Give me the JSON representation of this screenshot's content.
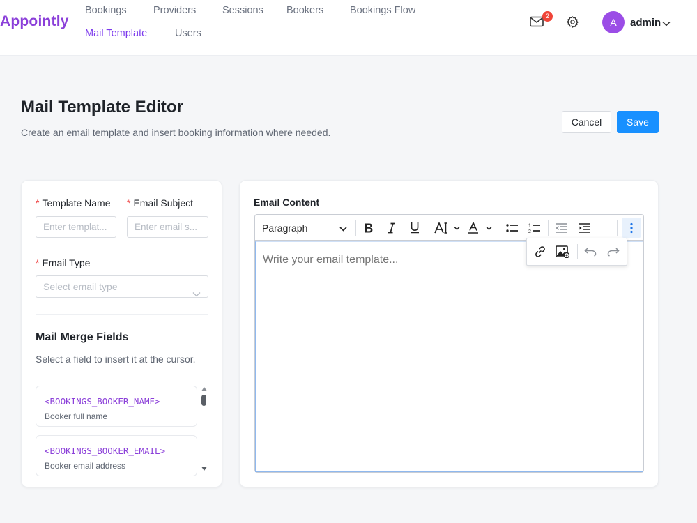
{
  "header": {
    "logo": "Appointly",
    "nav": {
      "bookings": "Bookings",
      "providers": "Providers",
      "sessions": "Sessions",
      "bookers": "Bookers",
      "bookings_flow": "Bookings Flow",
      "mail_template": "Mail Template",
      "users": "Users"
    },
    "active_nav": "Mail Template",
    "notification_count": "2",
    "user": {
      "avatar_letter": "A",
      "name": "admin"
    },
    "accent_color": "#7c3aed"
  },
  "page": {
    "title": "Mail Template Editor",
    "subtitle": "Create an email template and insert booking information where needed.",
    "cancel_label": "Cancel",
    "save_label": "Save"
  },
  "form": {
    "required_mark": "*",
    "template_name": {
      "label": "Template Name",
      "placeholder": "Enter templat...",
      "value": ""
    },
    "email_subject": {
      "label": "Email Subject",
      "placeholder": "Enter email s...",
      "value": ""
    },
    "email_type": {
      "label": "Email Type",
      "placeholder": "Select email type"
    }
  },
  "merge_fields": {
    "title": "Mail Merge Fields",
    "subtitle": "Select a field to insert it at the cursor.",
    "items": [
      {
        "code": "<BOOKINGS_BOOKER_NAME>",
        "description": "Booker full name"
      },
      {
        "code": "<BOOKINGS_BOOKER_EMAIL>",
        "description": "Booker email address"
      }
    ]
  },
  "editor": {
    "label": "Email Content",
    "block_format": "Paragraph",
    "placeholder": "Write your email template...",
    "toolbar_icons": [
      "bold-icon",
      "italic-icon",
      "underline-icon",
      "font-size-icon",
      "font-color-icon",
      "bullet-list-icon",
      "numbered-list-icon",
      "outdent-icon",
      "indent-icon",
      "more-icon"
    ],
    "overflow_icons": [
      "link-icon",
      "image-icon",
      "undo-icon",
      "redo-icon"
    ]
  },
  "colors": {
    "primary_button": "#1890ff",
    "required": "#ef4444",
    "badge": "#f04438",
    "avatar": "#9b4de6",
    "field_code": "#8b3fd9"
  }
}
